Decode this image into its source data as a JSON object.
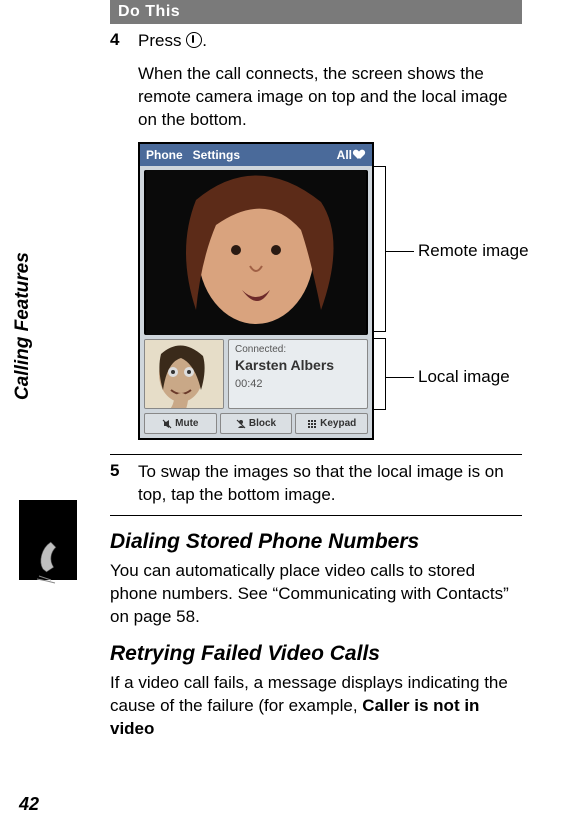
{
  "chapter_tab": "Calling Features",
  "page_number": "42",
  "do_this_header": "Do This",
  "steps": [
    {
      "num": "4",
      "line1_prefix": "Press ",
      "line1_suffix": ".",
      "body": "When the call connects, the screen shows the remote camera image on top and the local image on the bottom."
    },
    {
      "num": "5",
      "body": "To swap the images so that the local image is on top, tap the bottom image."
    }
  ],
  "phone_ui": {
    "menu_left_1": "Phone",
    "menu_left_2": "Settings",
    "menu_right": "All",
    "connected_label": "Connected:",
    "contact_name": "Karsten Albers",
    "call_time": "00:42",
    "softkeys": [
      "Mute",
      "Block",
      "Keypad"
    ]
  },
  "callouts": {
    "remote": "Remote image",
    "local": "Local image"
  },
  "sections": [
    {
      "heading": "Dialing Stored Phone Numbers",
      "body": "You can automatically place video calls to stored phone numbers. See “Communicating with Contacts” on page 58."
    },
    {
      "heading": "Retrying Failed Video Calls",
      "body_prefix": "If a video call fails, a message displays indicating the cause of the failure (for example, ",
      "body_bold": "Caller is not in video"
    }
  ]
}
